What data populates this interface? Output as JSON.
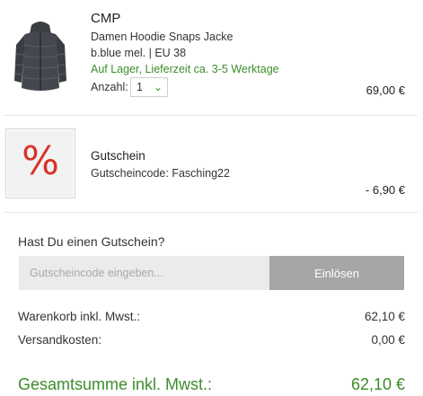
{
  "cart_item": {
    "brand": "CMP",
    "name": "Damen Hoodie Snaps Jacke",
    "variant": "b.blue mel. | EU 38",
    "availability": "Auf Lager, Lieferzeit ca. 3-5 Werktage",
    "quantity_label": "Anzahl:",
    "quantity_value": "1",
    "price": "69,00 €",
    "image_icon": "jacket-image"
  },
  "coupon_item": {
    "symbol": "%",
    "title": "Gutschein",
    "code_line": "Gutscheincode: Fasching22",
    "discount": "- 6,90 €"
  },
  "coupon_form": {
    "question": "Hast Du einen Gutschein?",
    "placeholder": "Gutscheincode eingeben...",
    "button_label": "Einlösen"
  },
  "summary": {
    "subtotal_label": "Warenkorb inkl. Mwst.:",
    "subtotal_value": "62,10 €",
    "shipping_label": "Versandkosten:",
    "shipping_value": "0,00 €",
    "total_label": "Gesamtsumme inkl. Mwst.:",
    "total_value": "62,10 €"
  },
  "colors": {
    "accent_green": "#3c8c2c",
    "coupon_red": "#d8322a",
    "button_gray": "#a6a6a6"
  }
}
